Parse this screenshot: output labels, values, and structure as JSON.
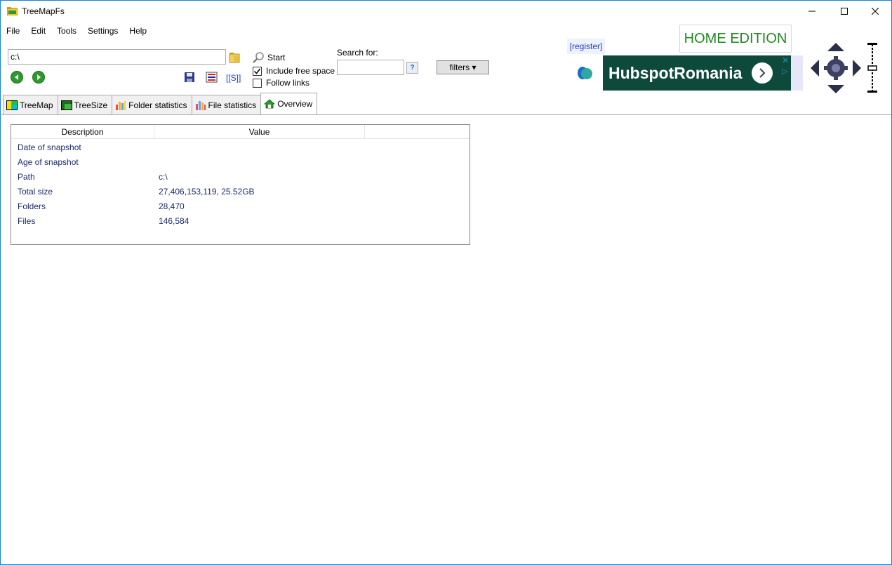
{
  "window": {
    "title": "TreeMapFs"
  },
  "menu": [
    "File",
    "Edit",
    "Tools",
    "Settings",
    "Help"
  ],
  "toolbar": {
    "path_value": "c:\\",
    "start_label": "Start",
    "include_free_space_label": "Include free space",
    "include_free_space_checked": true,
    "follow_links_label": "Follow links",
    "follow_links_checked": false,
    "search_label": "Search for:",
    "search_value": "",
    "search_help": "?",
    "filters_label": "filters ▾",
    "s_link": "[[S]]"
  },
  "banner": {
    "register": "[register]",
    "edition": "HOME EDITION",
    "ad_text": "HubspotRomania"
  },
  "tabs": [
    {
      "label": "TreeMap"
    },
    {
      "label": "TreeSize"
    },
    {
      "label": "Folder statistics"
    },
    {
      "label": "File statistics"
    },
    {
      "label": "Overview",
      "active": true
    }
  ],
  "overview": {
    "columns": [
      "Description",
      "Value"
    ],
    "rows": [
      {
        "desc": "Date of snapshot",
        "value": ""
      },
      {
        "desc": "Age of snapshot",
        "value": ""
      },
      {
        "desc": "Path",
        "value": "c:\\"
      },
      {
        "desc": "Total size",
        "value": "27,406,153,119, 25.52GB"
      },
      {
        "desc": "Folders",
        "value": "28,470"
      },
      {
        "desc": "Files",
        "value": "146,584"
      }
    ]
  },
  "colors": {
    "accent": "#1883d7",
    "edition_green": "#1f8a1f",
    "ad_green": "#0e4a3b",
    "nav_green": "#2e9a2e"
  }
}
